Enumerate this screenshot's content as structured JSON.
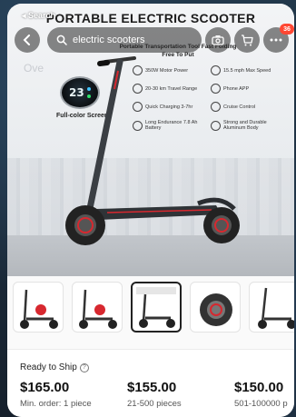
{
  "status": {
    "back_label": "◂ Search"
  },
  "nav": {
    "search_query": "electric scooters",
    "cart_badge": "36"
  },
  "hero": {
    "title": "PORTABLE ELECTRIC SCOOTER",
    "subtitle": "Portable Transportation Tool Fast Folding Free To Put",
    "screen_label": "Full-color Screen",
    "features": [
      "350W Motor Power",
      "15.5 mph Max Speed",
      "20-30 km Travel Range",
      "Phone APP",
      "Quick Charging 3-7hr",
      "Cruise Control",
      "Long Endurance 7.8 Ah Battery",
      "Strong and Durable Aluminum Body"
    ]
  },
  "tab_ghost": "Ove",
  "thumbnails": {
    "count": 5,
    "active_index": 2
  },
  "pricing": {
    "ready_label": "Ready to Ship",
    "tiers": [
      {
        "price": "$165.00",
        "moq": "Min. order: 1 piece"
      },
      {
        "price": "$155.00",
        "moq": "21-500 pieces"
      },
      {
        "price": "$150.00",
        "moq": "501-100000 p"
      }
    ]
  },
  "colors": {
    "badge": "#ff4733",
    "accent_red": "#d7282f"
  }
}
